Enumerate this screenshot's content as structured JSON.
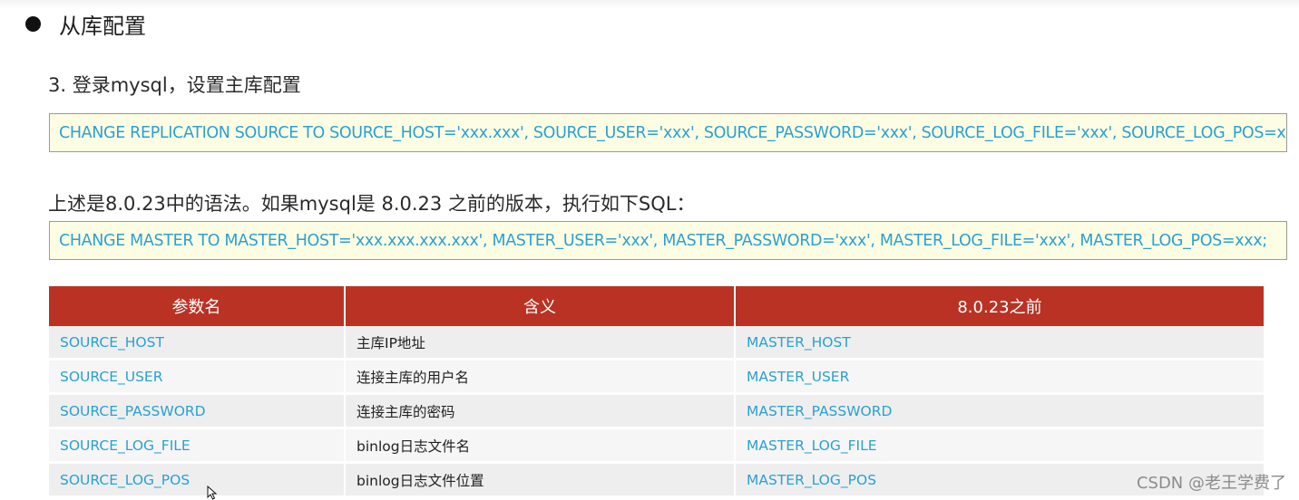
{
  "heading": "从库配置",
  "step_title": "3. 登录mysql，设置主库配置",
  "code_new": "CHANGE REPLICATION SOURCE TO SOURCE_HOST='xxx.xxx', SOURCE_USER='xxx', SOURCE_PASSWORD='xxx', SOURCE_LOG_FILE='xxx', SOURCE_LOG_POS=xxx;",
  "note": "上述是8.0.23中的语法。如果mysql是 8.0.23 之前的版本，执行如下SQL：",
  "code_old": "CHANGE MASTER TO MASTER_HOST='xxx.xxx.xxx.xxx', MASTER_USER='xxx', MASTER_PASSWORD='xxx', MASTER_LOG_FILE='xxx', MASTER_LOG_POS=xxx;",
  "table": {
    "headers": [
      "参数名",
      "含义",
      "8.0.23之前"
    ],
    "rows": [
      [
        "SOURCE_HOST",
        "主库IP地址",
        "MASTER_HOST"
      ],
      [
        "SOURCE_USER",
        "连接主库的用户名",
        "MASTER_USER"
      ],
      [
        "SOURCE_PASSWORD",
        "连接主库的密码",
        "MASTER_PASSWORD"
      ],
      [
        "SOURCE_LOG_FILE",
        "binlog日志文件名",
        "MASTER_LOG_FILE"
      ],
      [
        "SOURCE_LOG_POS",
        "binlog日志文件位置",
        "MASTER_LOG_POS"
      ]
    ]
  },
  "watermark": "CSDN @老王学费了",
  "icons": {
    "bullet": "filled-circle-bullet-icon",
    "cursor": "mouse-pointer-icon"
  },
  "colors": {
    "code_text": "#2aa1d2",
    "code_background": "#fdfde3",
    "table_header": "#b93224",
    "row_odd": "#eeeeee",
    "row_even": "#f6f6f6"
  }
}
